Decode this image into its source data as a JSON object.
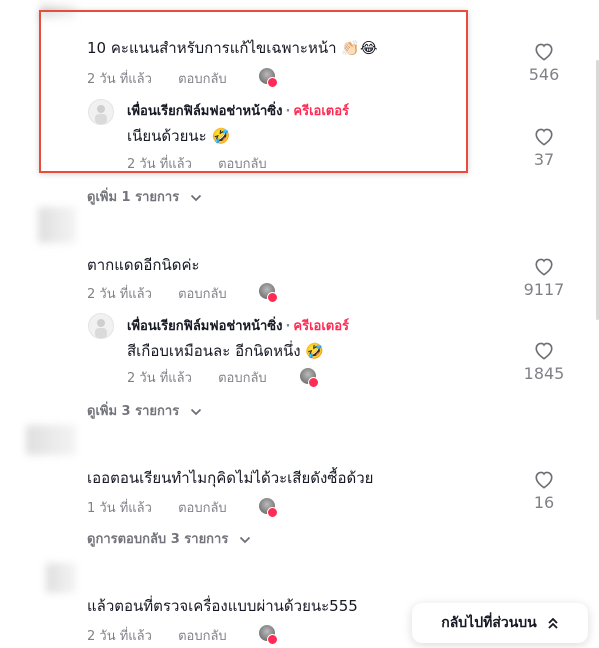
{
  "comments": [
    {
      "text": "10 คะแนนสำหรับการแก้ไขเฉพาะหน้า 👏🏻😂",
      "time": "2 วัน ที่แล้ว",
      "reply_label": "ตอบกลับ",
      "likes": "546",
      "reply": {
        "author": "เพื่อนเรียกฟิล์มฟอช่าหน้าซิ่ง",
        "separator": "·",
        "creator_tag": "ครีเอเตอร์",
        "text": "เนียนด้วยนะ 🤣",
        "time": "2 วัน ที่แล้ว",
        "reply_label": "ตอบกลับ",
        "likes": "37"
      },
      "view_more": "ดูเพิ่ม 1 รายการ"
    },
    {
      "text": "ตากแดดอีกนิดค่ะ",
      "time": "2 วัน ที่แล้ว",
      "reply_label": "ตอบกลับ",
      "likes": "9117",
      "reply": {
        "author": "เพื่อนเรียกฟิล์มฟอช่าหน้าซิ่ง",
        "separator": "·",
        "creator_tag": "ครีเอเตอร์",
        "text": "สีเกือบเหมือนละ อีกนิดหนึ่ง 🤣",
        "time": "2 วัน ที่แล้ว",
        "reply_label": "ตอบกลับ",
        "likes": "1845"
      },
      "view_more": "ดูเพิ่ม 3 รายการ"
    },
    {
      "text": "เออตอนเรียนทำไมกุคิดไม่ได้วะเสียดังซื้อด้วย",
      "time": "1 วัน ที่แล้ว",
      "reply_label": "ตอบกลับ",
      "likes": "16",
      "view_more": "ดูการตอบกลับ 3 รายการ"
    },
    {
      "text": "แล้วตอนที่ตรวจเครื่องแบบผ่านด้วยนะ555",
      "time": "2 วัน ที่แล้ว",
      "reply_label": "ตอบกลับ"
    }
  ],
  "back_to_top": "กลับไปที่ส่วนบน",
  "icons": {
    "like": "heart-outline-icon",
    "chevron": "chevron-down-icon",
    "back_to_top": "double-chevron-up-icon"
  },
  "colors": {
    "creator": "#fe2c55",
    "highlight": "#e74c3c"
  }
}
